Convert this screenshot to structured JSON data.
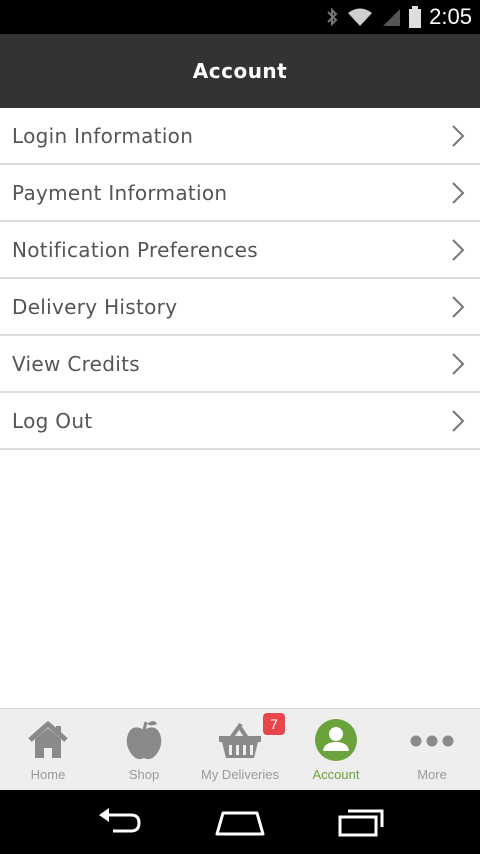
{
  "status_bar": {
    "time": "2:05",
    "icons": [
      "bluetooth-icon",
      "wifi-icon",
      "signal-icon",
      "battery-icon"
    ]
  },
  "header": {
    "title": "Account"
  },
  "menu": {
    "items": [
      {
        "label": "Login Information"
      },
      {
        "label": "Payment Information"
      },
      {
        "label": "Notification Preferences"
      },
      {
        "label": "Delivery History"
      },
      {
        "label": "View Credits"
      },
      {
        "label": "Log Out"
      }
    ]
  },
  "tabs": {
    "items": [
      {
        "label": "Home",
        "icon": "home-icon"
      },
      {
        "label": "Shop",
        "icon": "apple-icon"
      },
      {
        "label": "My Deliveries",
        "icon": "basket-icon",
        "badge": "7"
      },
      {
        "label": "Account",
        "icon": "account-icon",
        "active": true
      },
      {
        "label": "More",
        "icon": "more-icon"
      }
    ]
  },
  "colors": {
    "header_bg": "#333333",
    "accent_green": "#6aa33c",
    "badge_red": "#e8464b",
    "tab_inactive": "#9a9a9a"
  },
  "nav_bar": {
    "icons": [
      "back-icon",
      "home-nav-icon",
      "recents-icon"
    ]
  }
}
